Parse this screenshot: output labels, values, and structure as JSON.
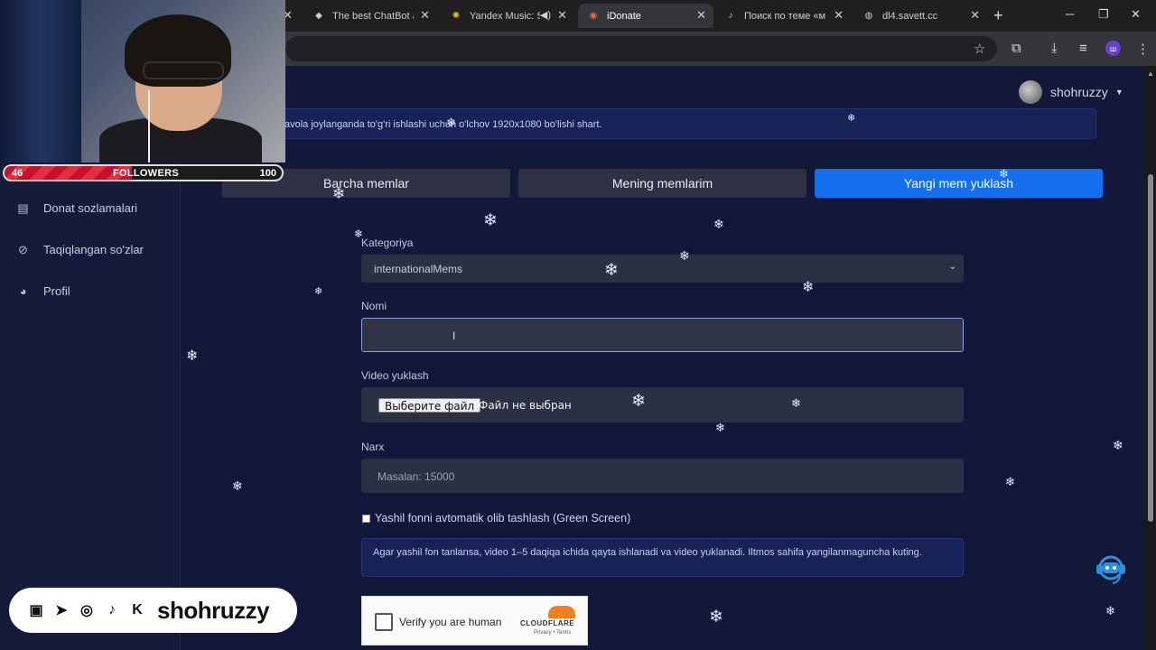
{
  "browser": {
    "tabs": [
      {
        "label": "",
        "icon": "close-icon",
        "active": false
      },
      {
        "label": "The best ChatBot and",
        "icon": "chatbot-icon",
        "active": false
      },
      {
        "label": "Yandex Music: Se",
        "icon": "yandex-music-icon",
        "active": false
      },
      {
        "label": "iDonate",
        "icon": "idonate-icon",
        "active": true
      },
      {
        "label": "Поиск по теме «ме",
        "icon": "tiktok-icon",
        "active": false
      },
      {
        "label": "dl4.savett.cc",
        "icon": "globe-icon",
        "active": false
      }
    ],
    "profile_letter": "ш"
  },
  "user": {
    "name": "shohruzzy"
  },
  "notice": {
    "text": "avola joylanganda to'g'ri ishlashi uchun o'lchov 1920x1080 bo'lishi shart."
  },
  "sidebar": {
    "items": [
      {
        "label": "Donat sozlamalari",
        "icon": "settings-table-icon"
      },
      {
        "label": "Taqiqlangan so'zlar",
        "icon": "ban-icon"
      },
      {
        "label": "Profil",
        "icon": "profile-icon"
      }
    ]
  },
  "tabs": {
    "all_memes": "Barcha memlar",
    "my_memes": "Mening memlarim",
    "upload_meme": "Yangi mem yuklash"
  },
  "form": {
    "category_label": "Kategoriya",
    "category_value": "internationalMems",
    "name_label": "Nomi",
    "name_value": "",
    "video_label": "Video yuklash",
    "file_button": "Выберите файл",
    "file_status": "Файл не выбран",
    "price_label": "Narx",
    "price_placeholder": "Masalan: 15000",
    "greenscreen_label": "Yashil fonni avtomatik olib tashlash (Green Screen)",
    "greenscreen_checked": false,
    "info_text": "Agar yashil fon tanlansa, video 1–5 daqiqa ichida qayta ishlanadi va video yuklanadi. Iltmos sahifa yangilanmaguncha kuting."
  },
  "captcha": {
    "label": "Verify you are human",
    "brand": "CLOUDFLARE",
    "links": "Privacy  •  Terms"
  },
  "overlay": {
    "followers_current": "46",
    "followers_label": "FOLLOWERS",
    "followers_goal": "100",
    "followers_progress": 0.46,
    "social_handle": "shohruzzy"
  },
  "colors": {
    "page_bg": "#11183a",
    "accent": "#1570ef",
    "inactive_tab": "#2d3143"
  }
}
